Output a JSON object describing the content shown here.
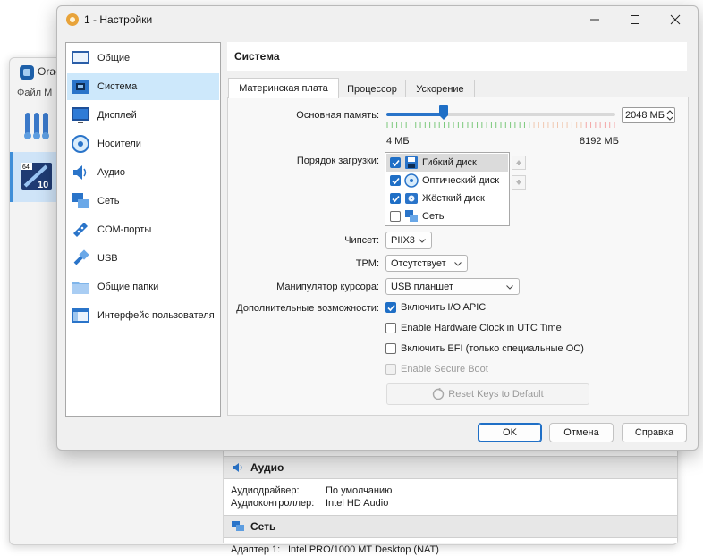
{
  "background_window": {
    "title": "Orac",
    "menu": "Файл    М",
    "audio": {
      "title": "Аудио",
      "rows": [
        {
          "key": "Аудиодрайвер:",
          "value": "По умолчанию"
        },
        {
          "key": "Аудиоконтроллер:",
          "value": "Intel HD Audio"
        }
      ]
    },
    "network": {
      "title": "Сеть",
      "rows": [
        {
          "key": "Адаптер 1:",
          "value": "Intel PRO/1000 MT Desktop (NAT)"
        }
      ]
    }
  },
  "dialog": {
    "title": "1 - Настройки",
    "nav": [
      {
        "label": "Общие",
        "icon": "general-icon"
      },
      {
        "label": "Система",
        "icon": "motherboard-icon",
        "selected": true
      },
      {
        "label": "Дисплей",
        "icon": "display-icon"
      },
      {
        "label": "Носители",
        "icon": "storage-icon"
      },
      {
        "label": "Аудио",
        "icon": "audio-icon"
      },
      {
        "label": "Сеть",
        "icon": "network-icon"
      },
      {
        "label": "COM-порты",
        "icon": "serial-port-icon"
      },
      {
        "label": "USB",
        "icon": "usb-icon"
      },
      {
        "label": "Общие папки",
        "icon": "shared-folder-icon"
      },
      {
        "label": "Интерфейс пользователя",
        "icon": "user-interface-icon"
      }
    ],
    "page_title": "Система",
    "tabs": [
      {
        "label": "Материнская плата",
        "selected": true
      },
      {
        "label": "Процессор"
      },
      {
        "label": "Ускорение"
      }
    ],
    "memory": {
      "label": "Основная память:",
      "value": "2048 МБ",
      "min_label": "4 МБ",
      "max_label": "8192 МБ",
      "slider_fraction": 0.25
    },
    "boot_order": {
      "label": "Порядок загрузки:",
      "items": [
        {
          "label": "Гибкий диск",
          "checked": true,
          "selected": true,
          "icon": "floppy-icon"
        },
        {
          "label": "Оптический диск",
          "checked": true,
          "icon": "optical-disc-icon"
        },
        {
          "label": "Жёсткий диск",
          "checked": true,
          "icon": "hard-disk-icon"
        },
        {
          "label": "Сеть",
          "checked": false,
          "icon": "network-icon"
        }
      ]
    },
    "chipset": {
      "label": "Чипсет:",
      "value": "PIIX3"
    },
    "tpm": {
      "label": "TPM:",
      "value": "Отсутствует"
    },
    "pointer": {
      "label": "Манипулятор курсора:",
      "value": "USB планшет"
    },
    "extended": {
      "label": "Дополнительные возможности:",
      "options": [
        {
          "label": "Включить I/O APIC",
          "checked": true,
          "enabled": true
        },
        {
          "label": "Enable Hardware Clock in UTC Time",
          "checked": false,
          "enabled": true
        },
        {
          "label": "Включить EFI (только специальные ОС)",
          "checked": false,
          "enabled": true
        },
        {
          "label": "Enable Secure Boot",
          "checked": false,
          "enabled": false
        }
      ]
    },
    "reset_keys": "Reset Keys to Default",
    "buttons": {
      "ok": "OK",
      "cancel": "Отмена",
      "help": "Справка"
    },
    "colors": {
      "accent": "#1f6fc6",
      "nav_selected": "#cde8fb"
    }
  }
}
